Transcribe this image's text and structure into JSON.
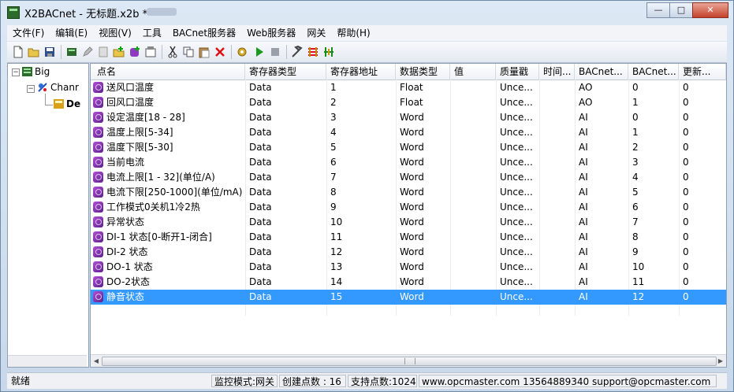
{
  "window": {
    "title": "X2BACnet - 无标题.x2b *"
  },
  "menu": [
    "文件(F)",
    "编辑(E)",
    "视图(V)",
    "工具",
    "BACnet服务器",
    "Web服务器",
    "网关",
    "帮助(H)"
  ],
  "tree": {
    "root": "Big",
    "channel": "Chanr",
    "device": "De"
  },
  "grid": {
    "columns": [
      "点名",
      "寄存器类型",
      "寄存器地址",
      "数据类型",
      "值",
      "质量戳",
      "时间...",
      "BACnet...",
      "BACnet...",
      "更新..."
    ],
    "rows": [
      [
        "送风口温度",
        "Data",
        "1",
        "Float",
        "",
        "Unce...",
        "",
        "AO",
        "0",
        "0"
      ],
      [
        "回风口温度",
        "Data",
        "2",
        "Float",
        "",
        "Unce...",
        "",
        "AO",
        "1",
        "0"
      ],
      [
        "设定温度[18 - 28]",
        "Data",
        "3",
        "Word",
        "",
        "Unce...",
        "",
        "AI",
        "0",
        "0"
      ],
      [
        "温度上限[5-34]",
        "Data",
        "4",
        "Word",
        "",
        "Unce...",
        "",
        "AI",
        "1",
        "0"
      ],
      [
        "温度下限[5-30]",
        "Data",
        "5",
        "Word",
        "",
        "Unce...",
        "",
        "AI",
        "2",
        "0"
      ],
      [
        "当前电流",
        "Data",
        "6",
        "Word",
        "",
        "Unce...",
        "",
        "AI",
        "3",
        "0"
      ],
      [
        "电流上限[1 - 32](单位/A)",
        "Data",
        "7",
        "Word",
        "",
        "Unce...",
        "",
        "AI",
        "4",
        "0"
      ],
      [
        "电流下限[250-1000](单位/mA)",
        "Data",
        "8",
        "Word",
        "",
        "Unce...",
        "",
        "AI",
        "5",
        "0"
      ],
      [
        "工作模式0关机1冷2热",
        "Data",
        "9",
        "Word",
        "",
        "Unce...",
        "",
        "AI",
        "6",
        "0"
      ],
      [
        "异常状态",
        "Data",
        "10",
        "Word",
        "",
        "Unce...",
        "",
        "AI",
        "7",
        "0"
      ],
      [
        "DI-1 状态[0-断开1-闭合]",
        "Data",
        "11",
        "Word",
        "",
        "Unce...",
        "",
        "AI",
        "8",
        "0"
      ],
      [
        "DI-2 状态",
        "Data",
        "12",
        "Word",
        "",
        "Unce...",
        "",
        "AI",
        "9",
        "0"
      ],
      [
        "DO-1 状态",
        "Data",
        "13",
        "Word",
        "",
        "Unce...",
        "",
        "AI",
        "10",
        "0"
      ],
      [
        "DO-2状态",
        "Data",
        "14",
        "Word",
        "",
        "Unce...",
        "",
        "AI",
        "11",
        "0"
      ],
      [
        "静音状态",
        "Data",
        "15",
        "Word",
        "",
        "Unce...",
        "",
        "AI",
        "12",
        "0"
      ]
    ],
    "selected_row": 14
  },
  "status": {
    "ready": "就绪",
    "mode": "监控模式:网关",
    "created": "创建点数 : 16",
    "supported": "支持点数:1024",
    "contact": "www.opcmaster.com 13564889340 support@opcmaster.com"
  },
  "colors": {
    "selection": "#3399ff",
    "point_icon": "#8e3bbf"
  }
}
